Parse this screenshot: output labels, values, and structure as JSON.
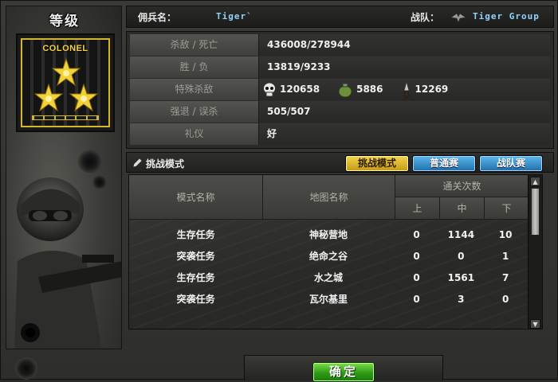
{
  "rank": {
    "title": "等级",
    "badge_text": "COLONEL"
  },
  "header": {
    "merc_label": "佣兵名：",
    "merc_name": "Tiger`",
    "team_label": "战队：",
    "team_name": "Tiger Group"
  },
  "stats": [
    {
      "key": "杀敌 / 死亡",
      "value": "436008/278944"
    },
    {
      "key": "胜 / 负",
      "value": "13819/9233"
    },
    {
      "key": "特殊杀敌",
      "value": ""
    },
    {
      "key": "强退 / 误杀",
      "value": "505/507"
    },
    {
      "key": "礼仪",
      "value": "好"
    }
  ],
  "special_kills": [
    {
      "icon": "skull-icon",
      "value": "120658"
    },
    {
      "icon": "grenade-icon",
      "value": "5886"
    },
    {
      "icon": "knife-icon",
      "value": "12269"
    }
  ],
  "challenge": {
    "title": "挑战模式",
    "tabs": [
      {
        "label": "挑战模式",
        "active": true
      },
      {
        "label": "普通赛",
        "active": false
      },
      {
        "label": "战队赛",
        "active": false
      }
    ]
  },
  "table": {
    "headers": {
      "mode": "模式名称",
      "map": "地图名称",
      "clears": "通关次数",
      "upper": "上",
      "middle": "中",
      "lower": "下"
    },
    "rows": [
      {
        "mode": "生存任务",
        "map": "神秘营地",
        "upper": "0",
        "middle": "1144",
        "lower": "10"
      },
      {
        "mode": "突袭任务",
        "map": "绝命之谷",
        "upper": "0",
        "middle": "0",
        "lower": "1"
      },
      {
        "mode": "生存任务",
        "map": "水之城",
        "upper": "0",
        "middle": "1561",
        "lower": "7"
      },
      {
        "mode": "突袭任务",
        "map": "瓦尔基里",
        "upper": "0",
        "middle": "3",
        "lower": "0"
      }
    ]
  },
  "confirm_label": "确定",
  "colors": {
    "gold": "#d4b62a",
    "tab_active": "#e0b52a",
    "tab_inactive": "#2f8ad0",
    "confirm": "#3aa41c",
    "name_blue": "#8fd3ff"
  }
}
